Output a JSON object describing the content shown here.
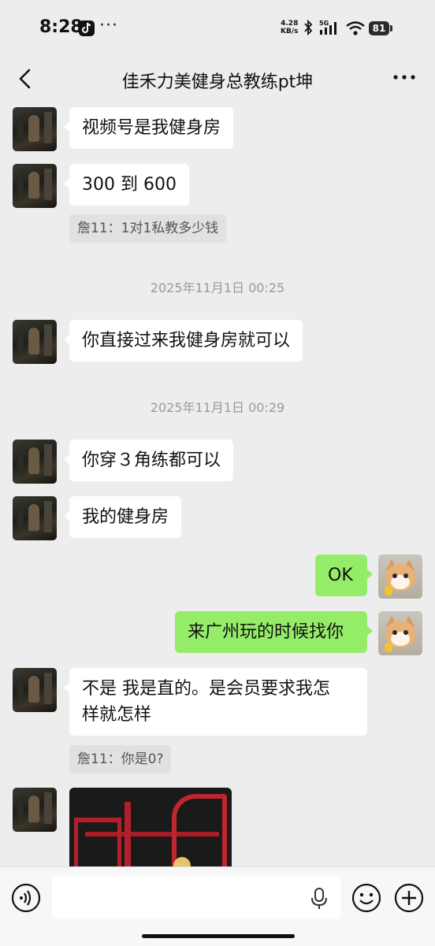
{
  "status_bar": {
    "time": "8:28",
    "more": "···",
    "net_speed_value": "4.28",
    "net_speed_unit": "KB/s",
    "signal": "5G",
    "battery": "81"
  },
  "nav": {
    "title": "佳禾力美健身总教练pt坤"
  },
  "messages": [
    {
      "side": "in",
      "text": "视频号是我健身房"
    },
    {
      "side": "in",
      "text": "300 到 600",
      "quote": "詹11：1对1私教多少钱"
    },
    {
      "side": "time",
      "text": "2025年11月1日 00:25"
    },
    {
      "side": "in",
      "text": "你直接过来我健身房就可以"
    },
    {
      "side": "time",
      "text": "2025年11月1日 00:29"
    },
    {
      "side": "in",
      "text": "你穿３角练都可以"
    },
    {
      "side": "in",
      "text": "我的健身房"
    },
    {
      "side": "out",
      "text": "OK"
    },
    {
      "side": "out",
      "text": "来广州玩的时候找你"
    },
    {
      "side": "in",
      "text_line1": "不是  我是直的。是会员要求我怎",
      "text_line2": "样就怎样",
      "quote": "詹11：你是0?"
    },
    {
      "side": "in",
      "type": "image"
    }
  ],
  "colors": {
    "background": "#EDEDED",
    "incoming_bubble": "#FFFFFF",
    "outgoing_bubble": "#95EC69",
    "quote_bg": "#E1E1E1",
    "timestamp": "#9A9A9A"
  },
  "icons": [
    "back-icon",
    "more-icon",
    "voice-icon",
    "mic-icon",
    "emoji-icon",
    "plus-icon",
    "bluetooth-icon",
    "wifi-icon",
    "signal-icon",
    "tiktok-icon"
  ]
}
